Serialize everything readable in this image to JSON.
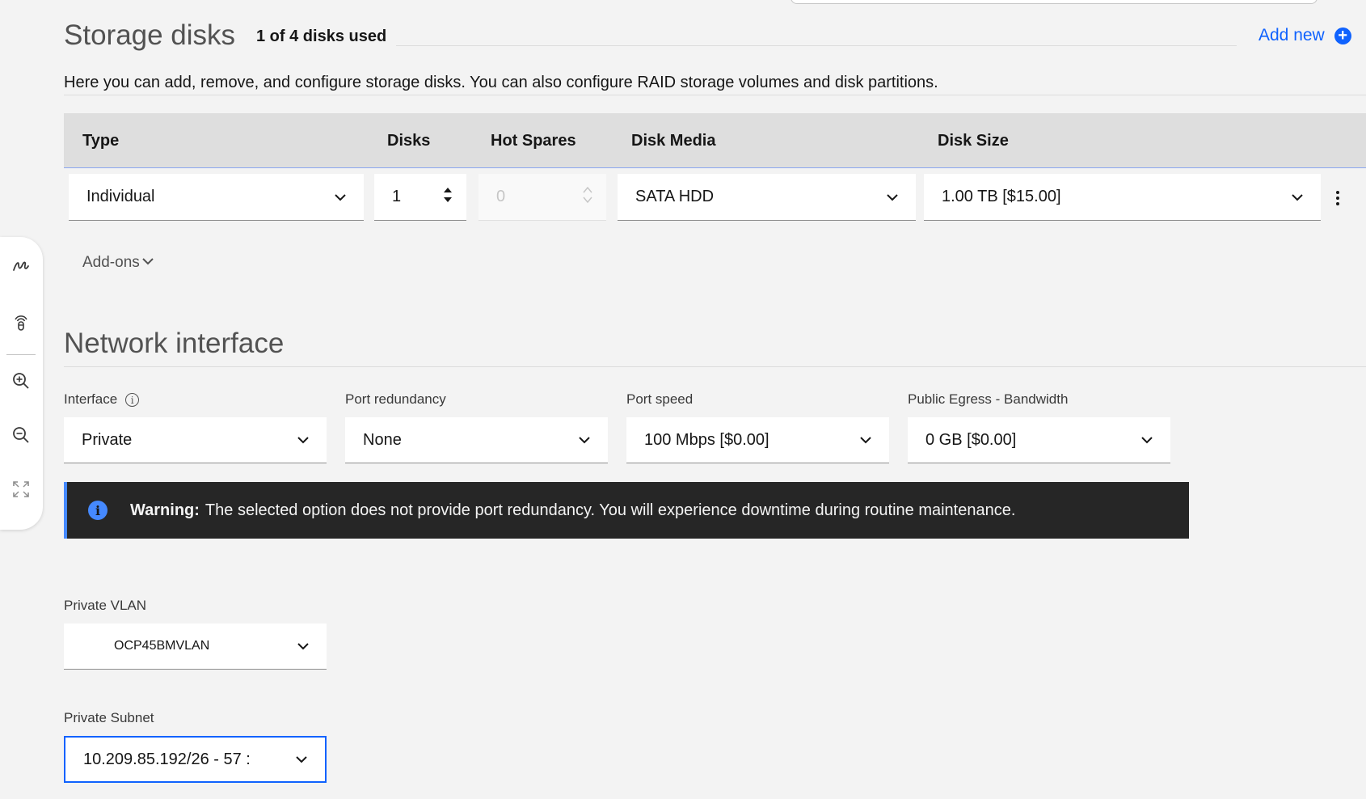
{
  "storage": {
    "title": "Storage disks",
    "disks_used": "1 of 4 disks used",
    "add_new": "Add new",
    "description": "Here you can add, remove, and configure storage disks. You can also configure RAID storage volumes and disk partitions.",
    "columns": [
      "Type",
      "Disks",
      "Hot Spares",
      "Disk Media",
      "Disk Size"
    ],
    "row": {
      "type": "Individual",
      "disks": "1",
      "hot_spares": "0",
      "disk_media": "SATA HDD",
      "disk_size": "1.00 TB [$15.00]"
    },
    "addons": "Add-ons"
  },
  "network": {
    "title": "Network interface",
    "interface_label": "Interface",
    "interface_value": "Private",
    "port_redundancy_label": "Port redundancy",
    "port_redundancy_value": "None",
    "port_speed_label": "Port speed",
    "port_speed_value": "100 Mbps [$0.00]",
    "egress_label": "Public Egress - Bandwidth",
    "egress_value": "0 GB [$0.00]",
    "warning_title": "Warning:",
    "warning_text": "The selected option does not provide port redundancy. You will experience downtime during routine maintenance.",
    "vlan_label": "Private VLAN",
    "vlan_value": "OCP45BMVLAN",
    "subnet_label": "Private Subnet",
    "subnet_value": "10.209.85.192/26 - 57 :"
  },
  "toolbar": {
    "icons": [
      "draw-icon",
      "touch-icon",
      "zoom-in-icon",
      "zoom-out-icon",
      "fullscreen-icon"
    ]
  },
  "colors": {
    "accent": "#0f62fe",
    "warning_bg": "#262626",
    "info_blue": "#4589ff"
  }
}
